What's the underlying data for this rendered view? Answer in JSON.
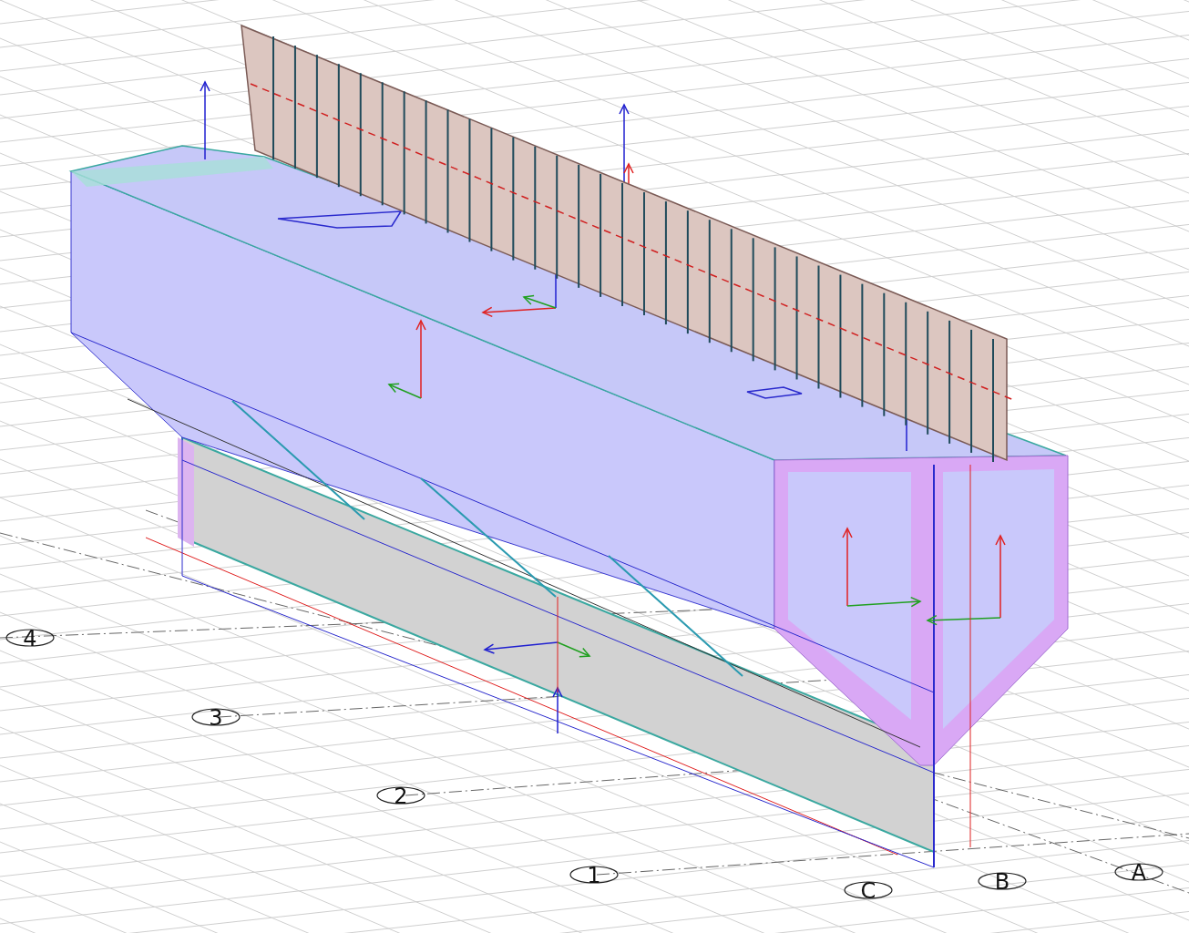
{
  "grid_axes": [
    {
      "label": "4"
    },
    {
      "label": "3"
    },
    {
      "label": "2"
    },
    {
      "label": "1"
    },
    {
      "label": "C"
    },
    {
      "label": "B"
    },
    {
      "label": "A"
    }
  ]
}
